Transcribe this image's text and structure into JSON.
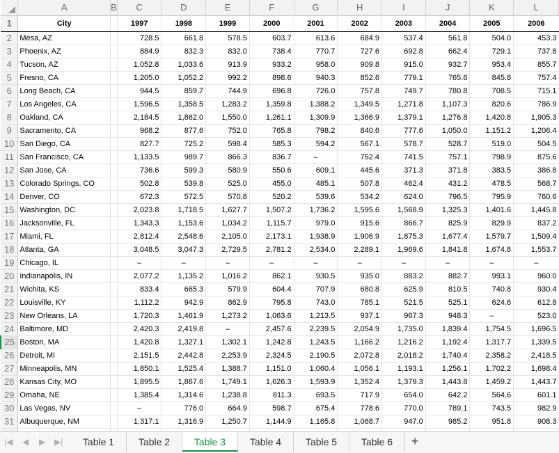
{
  "columns": [
    "A",
    "B",
    "C",
    "D",
    "E",
    "F",
    "G",
    "H",
    "I",
    "J",
    "K",
    "L"
  ],
  "header_row": [
    "City",
    "",
    "1997",
    "1998",
    "1999",
    "2000",
    "2001",
    "2002",
    "2003",
    "2004",
    "2005",
    "2006"
  ],
  "rows": [
    [
      "Mesa, AZ",
      "728.5",
      "661.8",
      "578.5",
      "603.7",
      "613.6",
      "684.9",
      "537.4",
      "561.8",
      "504.0",
      "453.3"
    ],
    [
      "Phoenix, AZ",
      "884.9",
      "832.3",
      "832.0",
      "738.4",
      "770.7",
      "727.6",
      "692.8",
      "662.4",
      "729.1",
      "737.8"
    ],
    [
      "Tucson, AZ",
      "1,052.8",
      "1,033.6",
      "913.9",
      "933.2",
      "958.0",
      "909.8",
      "915.0",
      "932.7",
      "953.4",
      "855.7"
    ],
    [
      "Fresno, CA",
      "1,205.0",
      "1,052.2",
      "992.2",
      "898.6",
      "940.3",
      "852.6",
      "779.1",
      "765.6",
      "845.8",
      "757.4"
    ],
    [
      "Long Beach, CA",
      "944.5",
      "859.7",
      "744.9",
      "696.8",
      "726.0",
      "757.8",
      "749.7",
      "780.8",
      "708.5",
      "715.1"
    ],
    [
      "Los Angeles, CA",
      "1,596.5",
      "1,358.5",
      "1,283.2",
      "1,359.8",
      "1,388.2",
      "1,349.5",
      "1,271.8",
      "1,107.3",
      "820.6",
      "786.9"
    ],
    [
      "Oakland, CA",
      "2,184.5",
      "1,862.0",
      "1,550.0",
      "1,261.1",
      "1,309.9",
      "1,366.9",
      "1,379.1",
      "1,276.8",
      "1,420.8",
      "1,905.3"
    ],
    [
      "Sacramento, CA",
      "968.2",
      "877.6",
      "752.0",
      "765.8",
      "798.2",
      "840.6",
      "777.6",
      "1,050.0",
      "1,151.2",
      "1,206.4"
    ],
    [
      "San Diego, CA",
      "827.7",
      "725.2",
      "598.4",
      "585.3",
      "594.2",
      "567.1",
      "578.7",
      "528.7",
      "519.0",
      "504.5"
    ],
    [
      "San Francisco, CA",
      "1,133.5",
      "989.7",
      "866.3",
      "836.7",
      "–",
      "752.4",
      "741.5",
      "757.1",
      "798.9",
      "875.6"
    ],
    [
      "San Jose, CA",
      "736.6",
      "599.3",
      "580.9",
      "550.6",
      "609.1",
      "445.6",
      "371.3",
      "371.8",
      "383.5",
      "386.8"
    ],
    [
      "Colorado Springs, CO",
      "502.8",
      "539.8",
      "525.0",
      "455.0",
      "485.1",
      "507.8",
      "462.4",
      "431.2",
      "478.5",
      "568.7"
    ],
    [
      "Denver, CO",
      "672.3",
      "572.5",
      "570.8",
      "520.2",
      "539.6",
      "534.2",
      "624.0",
      "796.5",
      "795.9",
      "760.6"
    ],
    [
      "Washington, DC",
      "2,023.8",
      "1,718.5",
      "1,627.7",
      "1,507.2",
      "1,736.2",
      "1,595.6",
      "1,568.9",
      "1,325.3",
      "1,401.6",
      "1,445.8"
    ],
    [
      "Jacksonville, FL",
      "1,343.3",
      "1,153.6",
      "1,034.2",
      "1,115.7",
      "979.0",
      "915.6",
      "866.7",
      "825.9",
      "829.9",
      "837.2"
    ],
    [
      "Miami, FL",
      "2,812.4",
      "2,548.6",
      "2,105.0",
      "2,173.1",
      "1,938.9",
      "1,906.9",
      "1,875.3",
      "1,677.4",
      "1,579.7",
      "1,509.4"
    ],
    [
      "Atlanta, GA",
      "3,048.5",
      "3,047.3",
      "2,729.5",
      "2,781.2",
      "2,534.0",
      "2,289.1",
      "1,969.6",
      "1,841.8",
      "1,674.8",
      "1,553.7"
    ],
    [
      "Chicago, IL",
      "–",
      "–",
      "–",
      "–",
      "–",
      "–",
      "–",
      "–",
      "–",
      "–"
    ],
    [
      "Indianapolis, IN",
      "2,077.2",
      "1,135.2",
      "1,016.2",
      "862.1",
      "930.5",
      "935.0",
      "883.2",
      "882.7",
      "993.1",
      "960.0"
    ],
    [
      "Wichita, KS",
      "833.4",
      "665.3",
      "579.9",
      "604.4",
      "707.9",
      "680.8",
      "625.9",
      "810.5",
      "740.8",
      "930.4"
    ],
    [
      "Louisville, KY",
      "1,112.2",
      "942.9",
      "862.9",
      "795.8",
      "743.0",
      "785.1",
      "521.5",
      "525.1",
      "624.6",
      "612.8"
    ],
    [
      "New Orleans, LA",
      "1,720.3",
      "1,461.9",
      "1,273.2",
      "1,063.6",
      "1,213.5",
      "937.1",
      "967.3",
      "948.3",
      "–",
      "523.0"
    ],
    [
      "Baltimore, MD",
      "2,420.3",
      "2,419.8",
      "–",
      "2,457.6",
      "2,239.5",
      "2,054.9",
      "1,735.0",
      "1,839.4",
      "1,754.5",
      "1,696.5"
    ],
    [
      "Boston, MA",
      "1,420.8",
      "1,327.1",
      "1,302.1",
      "1,242.8",
      "1,243.5",
      "1,166.2",
      "1,216.2",
      "1,192.4",
      "1,317.7",
      "1,339.5"
    ],
    [
      "Detroit, MI",
      "2,151.5",
      "2,442.8",
      "2,253.9",
      "2,324.5",
      "2,190.5",
      "2,072.8",
      "2,018.2",
      "1,740.4",
      "2,358.2",
      "2,418.5"
    ],
    [
      "Minneapolis, MN",
      "1,850.1",
      "1,525.4",
      "1,388.7",
      "1,151.0",
      "1,060.4",
      "1,056.1",
      "1,193.1",
      "1,256.1",
      "1,702.2",
      "1,698.4"
    ],
    [
      "Kansas City, MO",
      "1,895.5",
      "1,867.6",
      "1,749.1",
      "1,626.3",
      "1,593.9",
      "1,352.4",
      "1,379.3",
      "1,443.8",
      "1,459.2",
      "1,443.7"
    ],
    [
      "Omaha, NE",
      "1,385.4",
      "1,314.6",
      "1,238.8",
      "811.3",
      "693.5",
      "717.9",
      "654.0",
      "642.2",
      "564.6",
      "601.1"
    ],
    [
      "Las Vegas, NV",
      "–",
      "776.0",
      "664.9",
      "598.7",
      "675.4",
      "778.6",
      "770.0",
      "789.1",
      "743.5",
      "982.9"
    ],
    [
      "Albuquerque, NM",
      "1,317.1",
      "1,316.9",
      "1,250.7",
      "1,144.9",
      "1,165.8",
      "1,068.7",
      "947.0",
      "985.2",
      "951.8",
      "908.3"
    ]
  ],
  "active_row": 25,
  "tabs": [
    "Table 1",
    "Table 2",
    "Table 3",
    "Table 4",
    "Table 5",
    "Table 6"
  ],
  "active_tab": "Table 3",
  "add_tab_label": "+",
  "nav": [
    "|◀",
    "◀",
    "▶",
    "▶|"
  ],
  "colors": {
    "accent": "#1f8f4a",
    "header_bg": "#f2f2f2",
    "grid": "#e4e4e4"
  }
}
